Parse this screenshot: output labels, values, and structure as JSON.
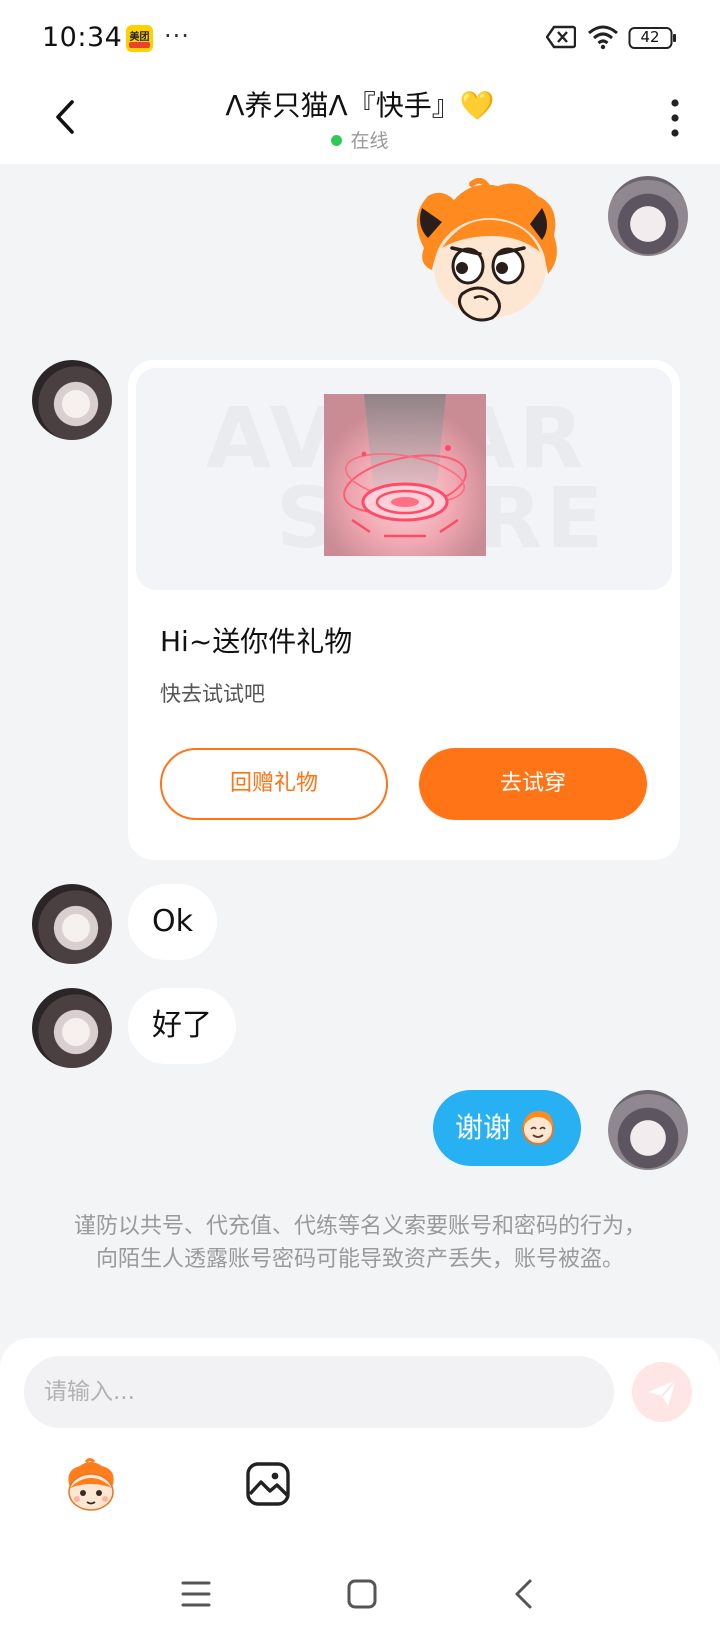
{
  "status_bar": {
    "time": "10:34",
    "meituan_label": "美团",
    "more": "···",
    "battery": "42"
  },
  "header": {
    "title": "Λ养只猫Λ『快手』💛",
    "status": "在线"
  },
  "gift_card": {
    "watermark_line1": "AVATAR",
    "watermark_line2": "STORE",
    "title": "Hi~送你件礼物",
    "subtitle": "快去试试吧",
    "return_button": "回赠礼物",
    "try_button": "去试穿"
  },
  "messages": [
    {
      "from": "other",
      "text": "Ok"
    },
    {
      "from": "other",
      "text": "好了"
    },
    {
      "from": "me",
      "text": "谢谢"
    }
  ],
  "warning": "谨防以共号、代充值、代练等名义索要账号和密码的行为，向陌生人透露账号密码可能导致资产丢失，账号被盗。",
  "input": {
    "placeholder": "请输入..."
  },
  "colors": {
    "accent": "#ff7417",
    "my_bubble": "#27b0f2",
    "online": "#31c956"
  }
}
